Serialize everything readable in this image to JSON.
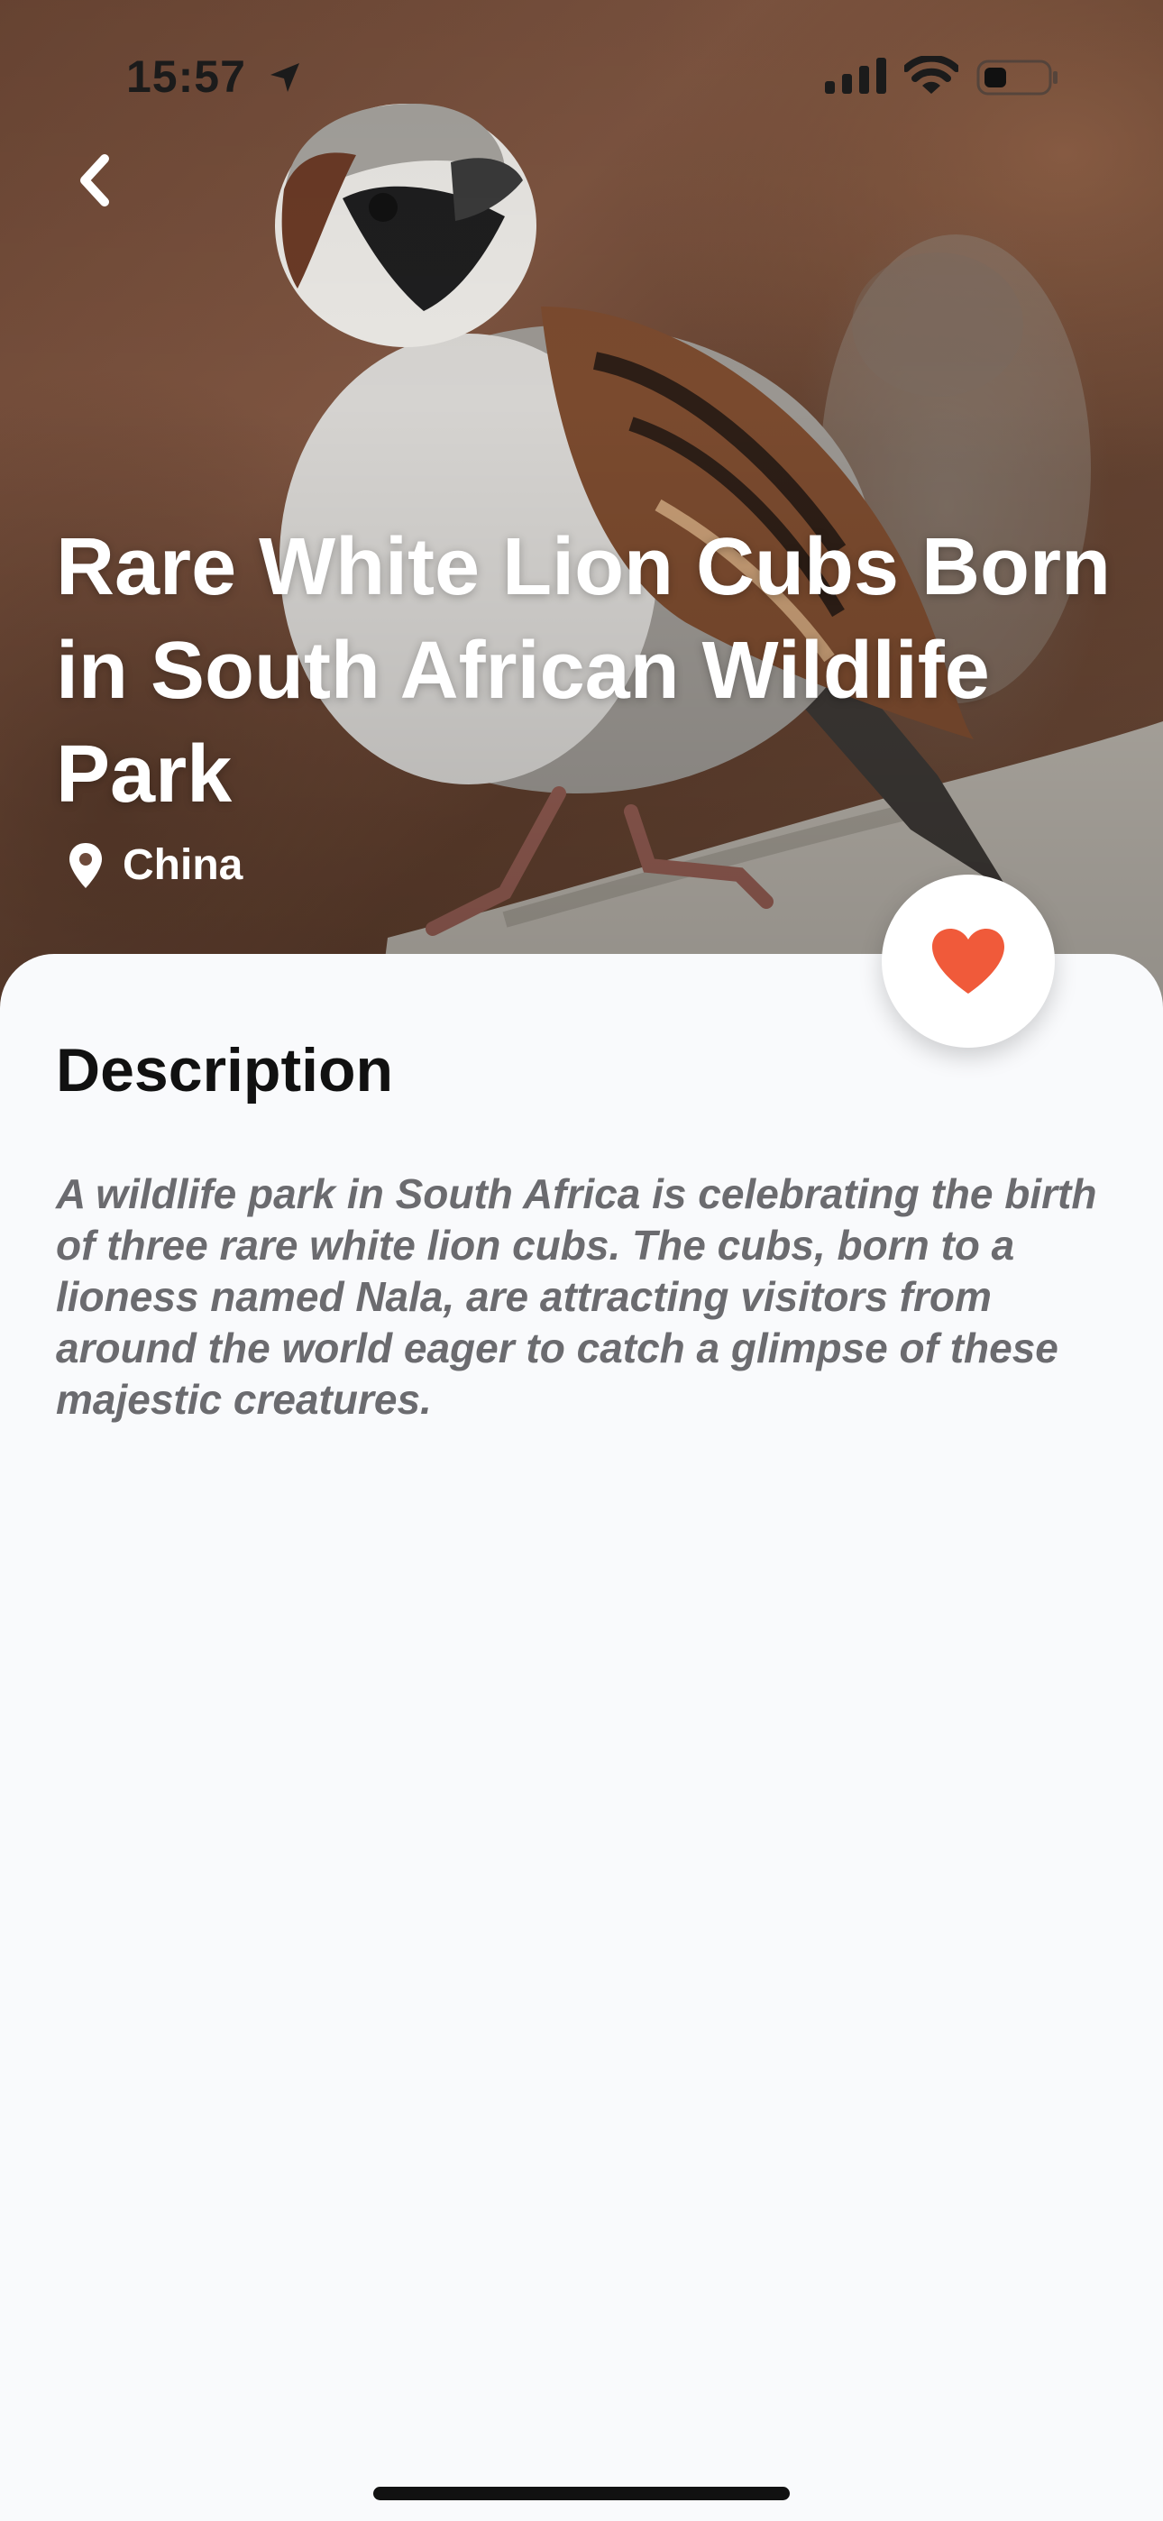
{
  "status_bar": {
    "time": "15:57",
    "icons": [
      "location-arrow-icon",
      "cellular-signal-icon",
      "wifi-icon",
      "battery-icon"
    ]
  },
  "navigation": {
    "back_icon": "chevron-left-icon"
  },
  "article": {
    "title": "Rare White Lion Cubs Born in South African Wildlife Park",
    "location": "China",
    "location_icon": "map-pin-icon",
    "favorite_icon": "heart-icon"
  },
  "description": {
    "heading": "Description",
    "body": "A wildlife park in South Africa is celebrating the birth of three rare white lion cubs. The cubs, born to a lioness named Nala, are attracting visitors from around the world eager to catch a glimpse of these majestic creatures."
  },
  "colors": {
    "accent": "#f05a3a",
    "sheet_background": "#f9fafc",
    "heading_text": "#111111",
    "body_text": "#6b6b6f"
  }
}
